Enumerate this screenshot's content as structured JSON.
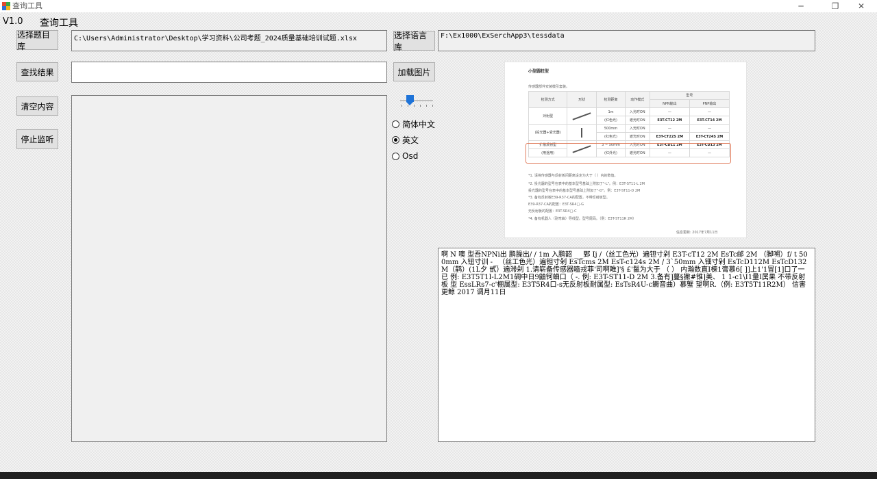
{
  "window": {
    "title": "查询工具",
    "controls": {
      "minimize": "─",
      "maximize": "❐",
      "close": "✕"
    }
  },
  "header": {
    "version": "V1.0",
    "heading": "查询工具"
  },
  "buttons": {
    "select_question_bank": "选择题目库",
    "search_result": "查找结果",
    "clear_content": "清空内容",
    "stop_listen": "停止监听",
    "select_language": "选择语言库",
    "load_image": "加载图片"
  },
  "fields": {
    "question_bank_path": "C:\\Users\\Administrator\\Desktop\\学习资料\\公司考题_2024质量基础培训试题.xlsx",
    "language_path": "F:\\Ex1000\\ExSerchApp3\\tessdata",
    "search_input": "",
    "result_text": ""
  },
  "slider": {
    "value": 0.3
  },
  "languages": {
    "options": [
      "简体中文",
      "英文",
      "Osd"
    ],
    "selected": "英文"
  },
  "preview": {
    "heading": "小型圆柱型",
    "subtitle": "传感器部件安装模引套装。",
    "table_header": [
      "检测方式",
      "形状",
      "检测距离",
      "动作模式",
      "型号"
    ],
    "table_subheader": [
      "NPN输出",
      "PNP输出"
    ],
    "rows": [
      [
        "对射型",
        "",
        "1m",
        "入光时ON",
        "—",
        "—"
      ],
      [
        "(投光器+受光器)",
        "",
        "(红色光)",
        "遮光时ON",
        "E3T-CT12 2M",
        "E3T-CT14 2M"
      ],
      [
        "",
        "",
        "500mm",
        "入光时ON",
        "—",
        "—"
      ],
      [
        "",
        "",
        "(红色光)",
        "遮光时ON",
        "E3T-CT22S 2M",
        "E3T-CT24S 2M"
      ],
      [
        "扩散反射型",
        "",
        "3 ~ 50mm",
        "入光时ON",
        "E3T-CD11 2M",
        "E3T-CD13 2M"
      ],
      [
        "(用途用)",
        "",
        "(红外光)",
        "遮光时ON",
        "—",
        "—"
      ]
    ],
    "notes": [
      "*1. 请将传感器与反射板间距离设定为大于（  ）内的数值。",
      "*2. 投光器的型号在表中的基本型号基础上附加了\"-L\"。例：E3T-ST11-L 2M",
      "     投光器的型号在表中的基本型号基础上附加了\"-D\"。例：E3T-ST11-D 2M",
      "*3. 备有反射板E39-R37-CA的配置，不带反射板型。",
      "     E39-R37-CA的配置：E3T-SR4□-G",
      "     无反射板的配置：E3T-SR4□-C",
      "*4. 备有机器人（耐弯曲）导线型。型号尾码。（例：E3T-ST11R 2M）"
    ],
    "footer": "信息更新: 2017年7月11日"
  },
  "ocr_output": "啊 N 噢 型吾NPNi出 鹏臊出/ / 1m 入鹏韶 _ _鄄 Ij /（丝工色光）遍钽寸剁 E3T-cT12 2M EsTc邮 2M （脚嗍）f/ t 500mm 入钮寸训 - _（丝工色光）遍钽寸剁 EsTcms 2M EsT-c124s 2M / 3`50mm 入钿寸剁 EsTcD112M EsTcD132M（鹳）(1L夕 甙）遍滞剁 1.请崭备传感器瞌戎菲'司啊睢]'§ £'鬣为大于 （ ） 内瀚数直I楝1膏慕6[ ]]上1'1冒[1]口了一 已 例: E3T5T1I-L2M1碉中日9鼬钶蛐口（ -. 例: E3T-ST11-D 2M 3.备有]蔓§撇#锥]美、 1 1-c1\\I1量I属果 不带反射板 型 EssLRs7-c'棚属型: E3T5R4口-s无反射板耐属型: EsTsR4U-c鳜音曲）慕蟹 望啊R.（例: E3T5T11R2M） 信害更鲸 2017 调月11日"
}
